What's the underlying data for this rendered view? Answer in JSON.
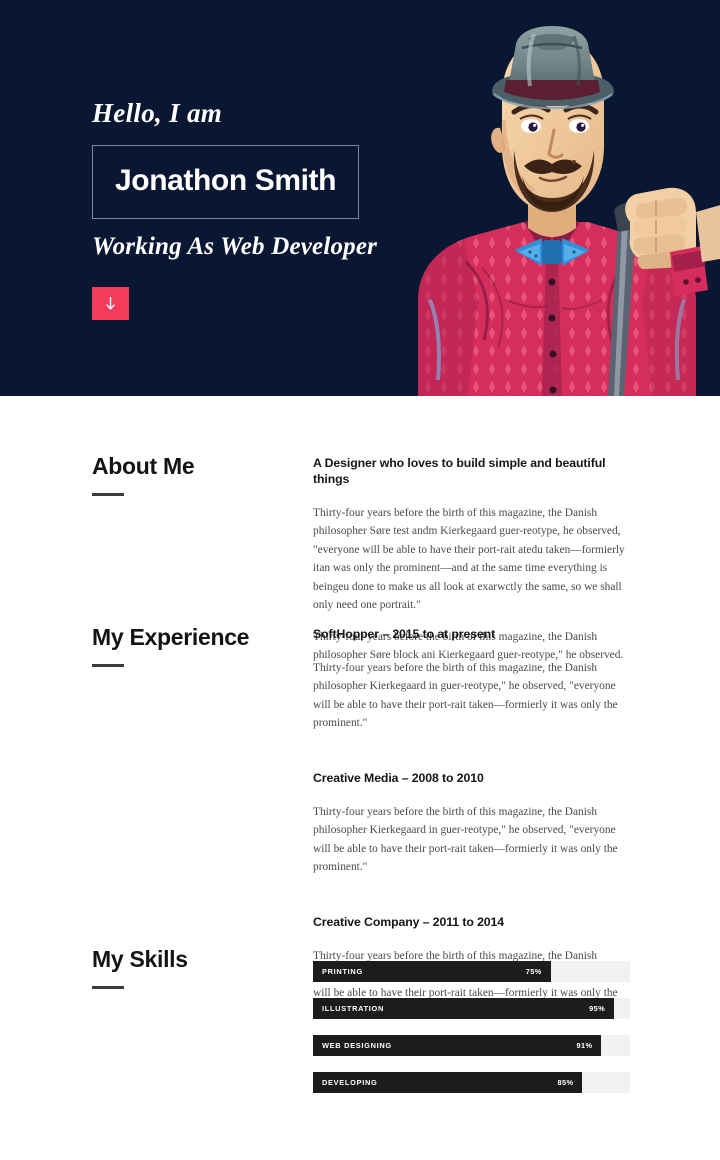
{
  "theme": {
    "hero_bg": "#0a1733",
    "accent": "#f43b5c",
    "text_dark": "#141414",
    "bar_fill": "#1c1c1c",
    "bar_track": "#f2f2f2"
  },
  "hero": {
    "greeting": "Hello, I am",
    "name": "Jonathon Smith",
    "tagline": "Working As Web Developer",
    "scroll_button_icon": "arrow-down-icon"
  },
  "about": {
    "heading": "About Me",
    "subheading": "A Designer who loves to build simple and beautiful things",
    "paragraphs": [
      "Thirty-four years before the birth of this magazine, the Danish philosopher Søre test andm Kierkegaard guer-reotype, he observed, \"everyone will be able to have their port-rait atedu taken—formierly itan was only the prominent—and at the same time everything is beingeu done to make us all look at exarwctly the same, so we shall only need one portrait.\"",
      "Thirty-four years before the birth of this magazine, the Danish philosopher Søre  block ani Kierkegaard guer-reotype,\" he observed."
    ]
  },
  "experience": {
    "heading": "My Experience",
    "items": [
      {
        "title": "SoftHopper – 2015 to at present",
        "text": "Thirty-four years before the birth of this magazine, the Danish philosopher Kierkegaard in guer-reotype,\" he observed, \"everyone will be able to have their port-rait taken—formierly it was only the prominent.\""
      },
      {
        "title": "Creative Media – 2008 to 2010",
        "text": "Thirty-four years before the birth of this magazine, the Danish philosopher Kierkegaard in guer-reotype,\" he observed, \"everyone will be able to have their port-rait taken—formierly it was only the prominent.\""
      },
      {
        "title": "Creative Company – 2011 to 2014",
        "text": "Thirty-four years before the birth of this magazine, the Danish philosopher Kierkegaard in guer-reotype,\" he observed, \"everyone will be able to have their port-rait taken—formierly it was only the prominent.\""
      }
    ]
  },
  "skills": {
    "heading": "My Skills",
    "items": [
      {
        "name": "PRINTING",
        "percent_label": "75%",
        "percent": 75
      },
      {
        "name": "ILLUSTRATION",
        "percent_label": "95%",
        "percent": 95
      },
      {
        "name": "WEB DESIGNING",
        "percent_label": "91%",
        "percent": 91
      },
      {
        "name": "DEVELOPING",
        "percent_label": "85%",
        "percent": 85
      }
    ]
  }
}
